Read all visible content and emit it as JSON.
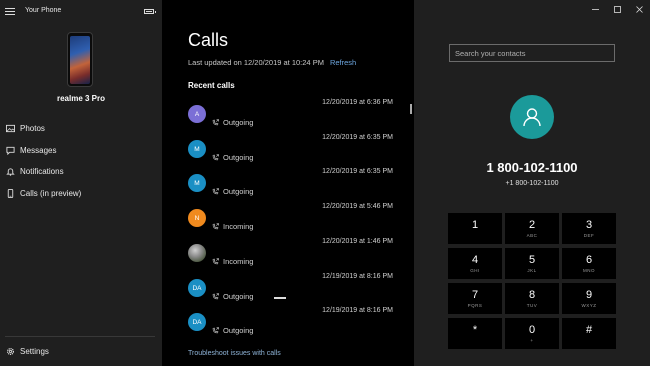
{
  "app": {
    "title": "Your Phone"
  },
  "device": {
    "name": "realme 3 Pro"
  },
  "nav": {
    "items": [
      {
        "label": "Photos",
        "icon": "photos-icon"
      },
      {
        "label": "Messages",
        "icon": "messages-icon"
      },
      {
        "label": "Notifications",
        "icon": "bell-icon"
      },
      {
        "label": "Calls (in preview)",
        "icon": "phone-icon"
      }
    ],
    "settings_label": "Settings"
  },
  "calls": {
    "title": "Calls",
    "last_updated": "Last updated on 12/20/2019 at 10:24 PM",
    "refresh_label": "Refresh",
    "recent_label": "Recent calls",
    "rows": [
      {
        "initial": "A",
        "color": "#7b6fd6",
        "type": "Outgoing",
        "time": "12/20/2019 at 6:36 PM"
      },
      {
        "initial": "M",
        "color": "#1a8fc4",
        "type": "Outgoing",
        "time": "12/20/2019 at 6:35 PM"
      },
      {
        "initial": "M",
        "color": "#1a8fc4",
        "type": "Outgoing",
        "time": "12/20/2019 at 6:35 PM"
      },
      {
        "initial": "N",
        "color": "#f08a1e",
        "type": "Incoming",
        "time": "12/20/2019 at 5:46 PM"
      },
      {
        "initial": "",
        "color": "photo",
        "type": "Incoming",
        "time": "12/20/2019 at 1:46 PM"
      },
      {
        "initial": "DA",
        "color": "#1a8fc4",
        "type": "Outgoing",
        "time": "12/19/2019 at 8:16 PM"
      },
      {
        "initial": "DA",
        "color": "#1a8fc4",
        "type": "Outgoing",
        "time": "12/19/2019 at 8:16 PM"
      }
    ],
    "troubleshoot_label": "Troubleshoot issues with calls"
  },
  "dialer": {
    "search_placeholder": "Search your contacts",
    "contact_number": "1 800-102-1100",
    "contact_sub": "+1 800-102-1100",
    "accent_color": "#1b9a9a",
    "keys": [
      {
        "digit": "1",
        "letters": ""
      },
      {
        "digit": "2",
        "letters": "ABC"
      },
      {
        "digit": "3",
        "letters": "DEF"
      },
      {
        "digit": "4",
        "letters": "GHI"
      },
      {
        "digit": "5",
        "letters": "JKL"
      },
      {
        "digit": "6",
        "letters": "MNO"
      },
      {
        "digit": "7",
        "letters": "PQRS"
      },
      {
        "digit": "8",
        "letters": "TUV"
      },
      {
        "digit": "9",
        "letters": "WXYZ"
      },
      {
        "digit": "*",
        "letters": ""
      },
      {
        "digit": "0",
        "letters": "+"
      },
      {
        "digit": "#",
        "letters": ""
      }
    ]
  }
}
